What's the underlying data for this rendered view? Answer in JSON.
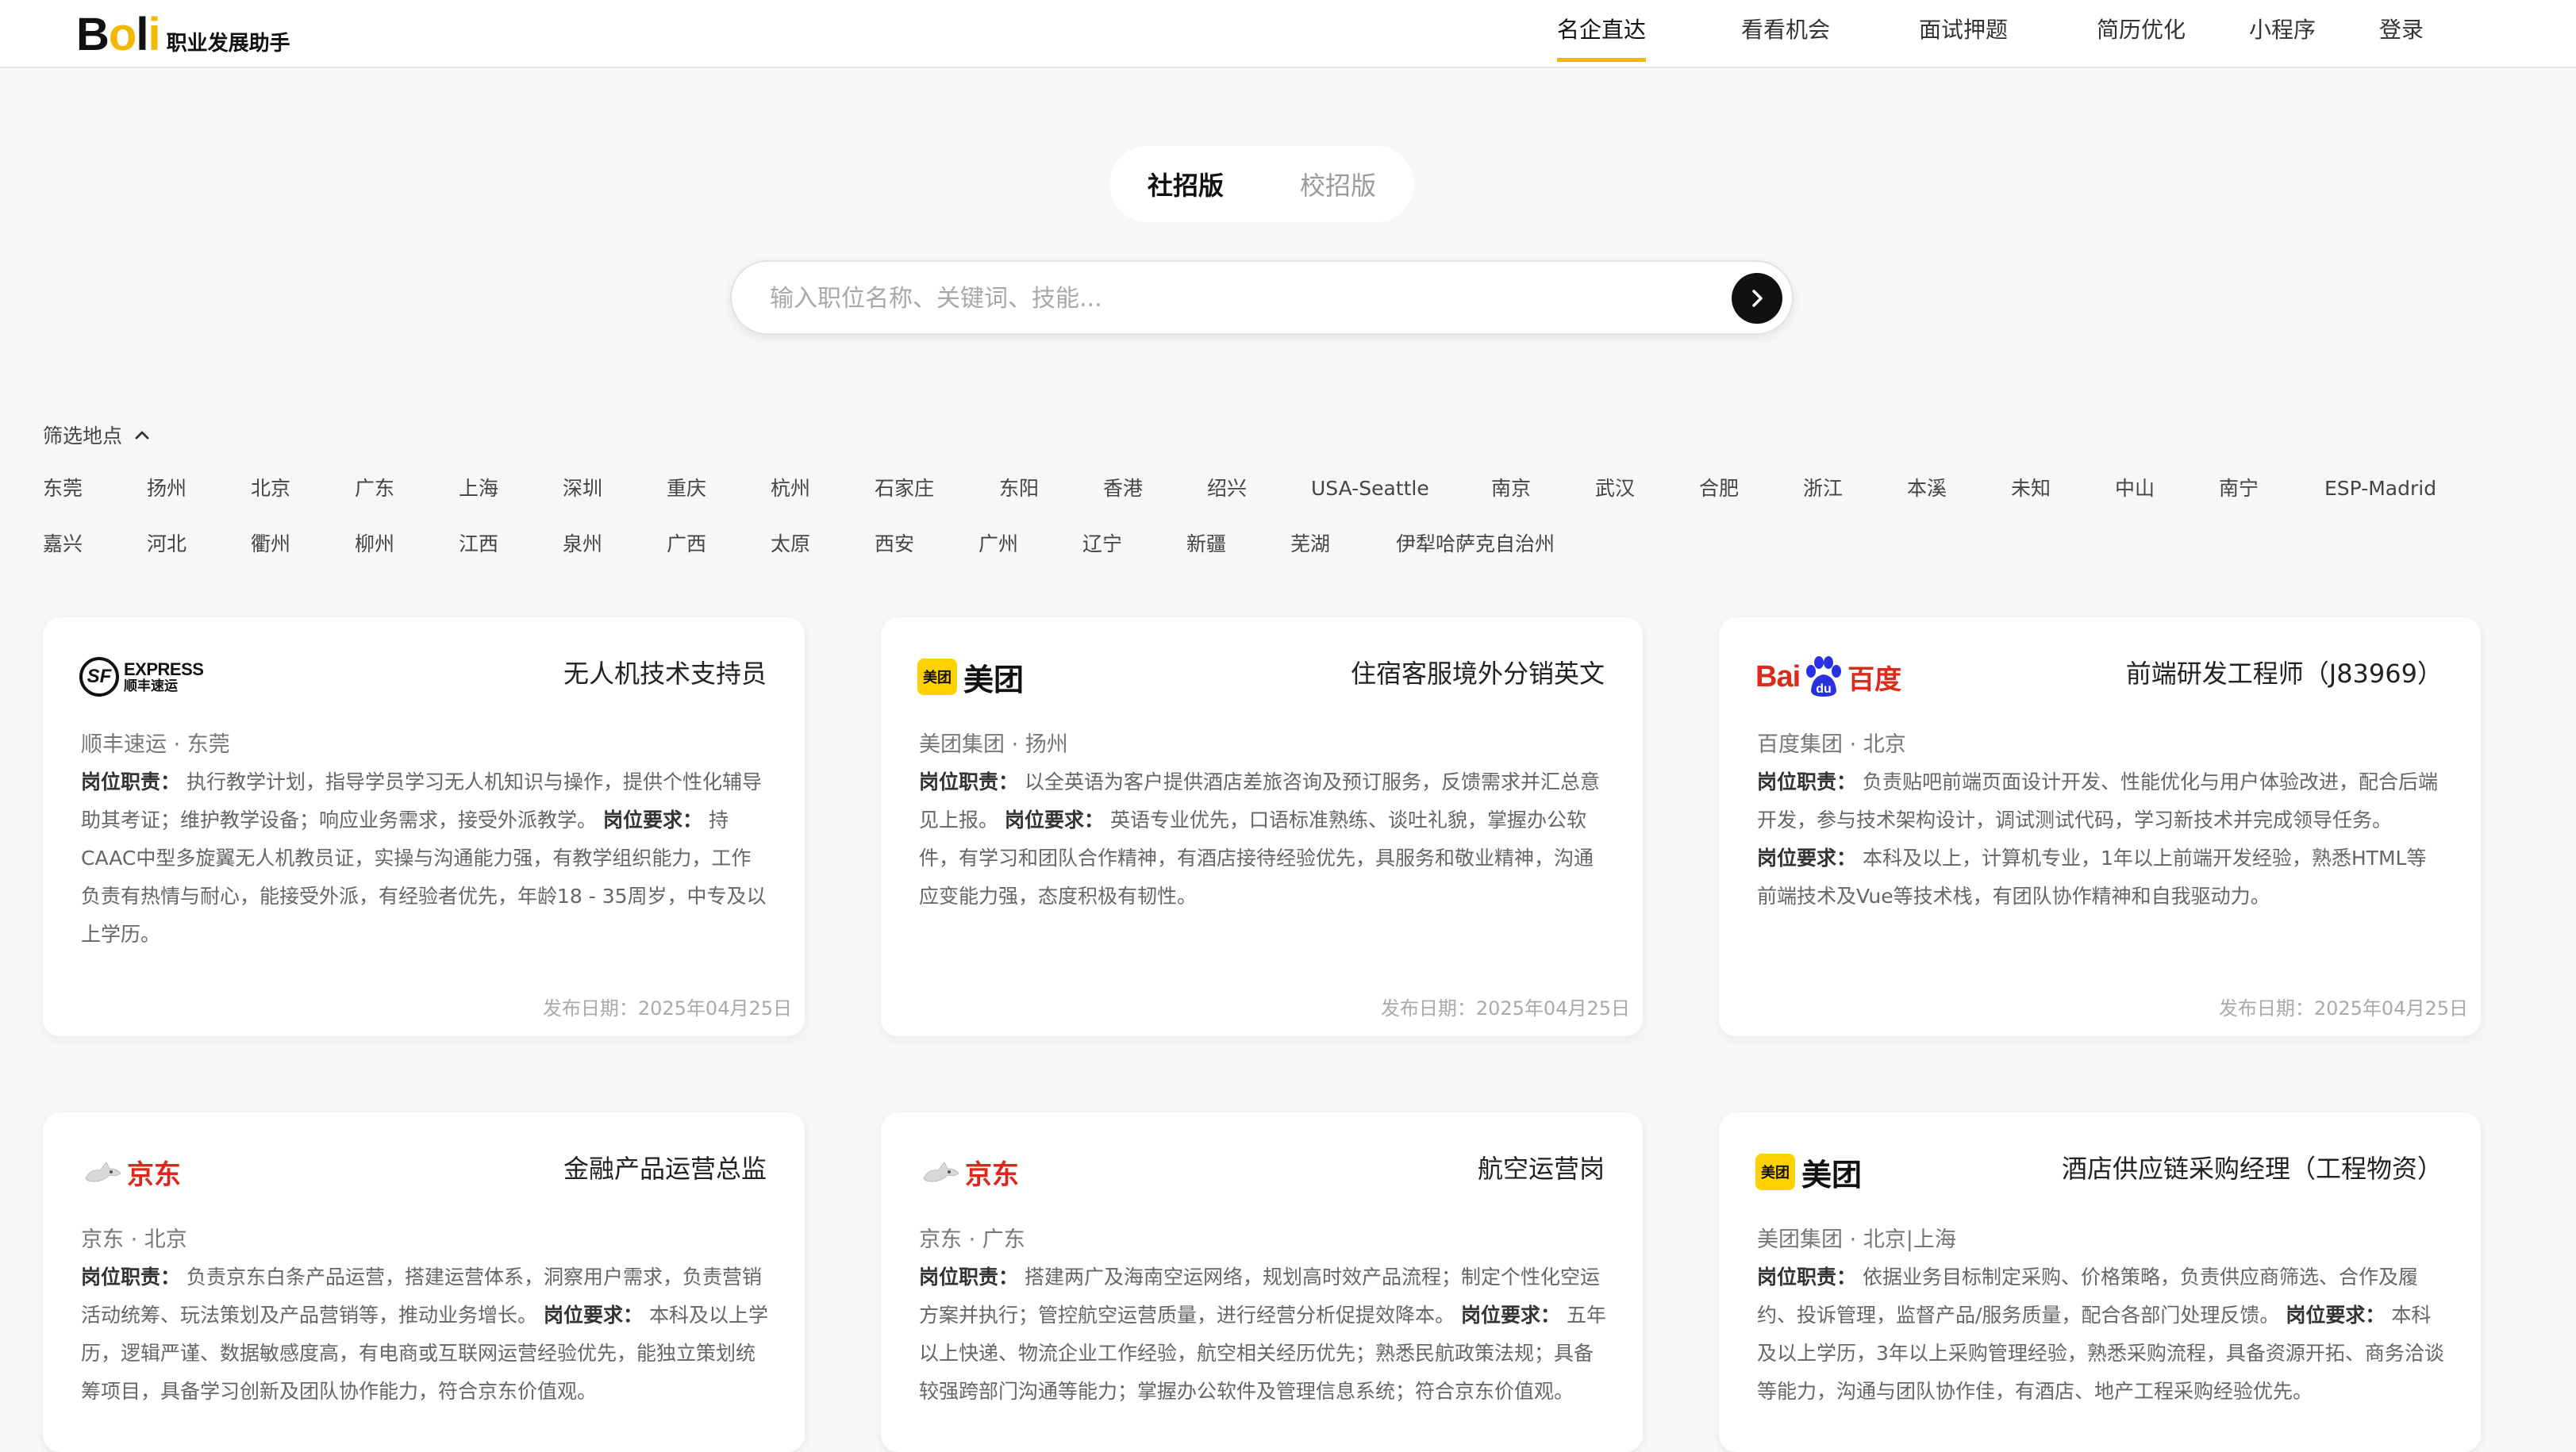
{
  "brand": {
    "logo_b": "B",
    "logo_o": "o",
    "logo_l": "l",
    "logo_i": "i",
    "subtitle": "职业发展助手"
  },
  "nav": [
    {
      "label": "名企直达",
      "active": true
    },
    {
      "label": "看看机会"
    },
    {
      "label": "面试押题"
    },
    {
      "label": "简历优化"
    },
    {
      "label": "小程序"
    },
    {
      "label": "登录"
    }
  ],
  "tabs": {
    "social": "社招版",
    "campus": "校招版"
  },
  "search": {
    "placeholder": "输入职位名称、关键词、技能..."
  },
  "filter": {
    "title": "筛选地点",
    "row1": [
      "东莞",
      "扬州",
      "北京",
      "广东",
      "上海",
      "深圳",
      "重庆",
      "杭州",
      "石家庄",
      "东阳",
      "香港",
      "绍兴",
      "USA-Seattle",
      "南京",
      "武汉",
      "合肥",
      "浙江",
      "本溪",
      "未知",
      "中山",
      "南宁",
      "ESP-Madrid"
    ],
    "row2": [
      "嘉兴",
      "河北",
      "衢州",
      "柳州",
      "江西",
      "泉州",
      "广西",
      "太原",
      "西安",
      "广州",
      "辽宁",
      "新疆",
      "芜湖",
      "伊犁哈萨克自治州"
    ]
  },
  "labels": {
    "duty": "岗位职责：",
    "req": "岗位要求：",
    "date_prefix": "发布日期："
  },
  "logos": {
    "sf_mark": "SF",
    "sf_en": "EXPRESS",
    "sf_cn": "顺丰速运",
    "meituan_badge": "美团",
    "meituan_text": "美团",
    "baidu_bai": "Bai",
    "baidu_du": "du",
    "baidu_cn": "百度",
    "jd_text": "京东"
  },
  "jobs": [
    {
      "title": "无人机技术支持员",
      "company": "顺丰速运 · 东莞",
      "duty": "执行教学计划，指导学员学习无人机知识与操作，提供个性化辅导助其考证；维护教学设备；响应业务需求，接受外派教学。",
      "req": "持CAAC中型多旋翼无人机教员证，实操与沟通能力强，有教学组织能力，工作负责有热情与耐心，能接受外派，有经验者优先，年龄18 - 35周岁，中专及以上学历。",
      "date": "2025年04月25日"
    },
    {
      "title": "住宿客服境外分销英文",
      "company": "美团集团 · 扬州",
      "duty": "以全英语为客户提供酒店差旅咨询及预订服务，反馈需求并汇总意见上报。",
      "req": "英语专业优先，口语标准熟练、谈吐礼貌，掌握办公软件，有学习和团队合作精神，有酒店接待经验优先，具服务和敬业精神，沟通应变能力强，态度积极有韧性。",
      "date": "2025年04月25日"
    },
    {
      "title": "前端研发工程师（J83969）",
      "company": "百度集团 · 北京",
      "duty": "负责贴吧前端页面设计开发、性能优化与用户体验改进，配合后端开发，参与技术架构设计，调试测试代码，学习新技术并完成领导任务。",
      "req": "本科及以上，计算机专业，1年以上前端开发经验，熟悉HTML等前端技术及Vue等技术栈，有团队协作精神和自我驱动力。",
      "date": "2025年04月25日"
    },
    {
      "title": "金融产品运营总监",
      "company": "京东 · 北京",
      "duty": "负责京东白条产品运营，搭建运营体系，洞察用户需求，负责营销活动统筹、玩法策划及产品营销等，推动业务增长。",
      "req": "本科及以上学历，逻辑严谨、数据敏感度高，有电商或互联网运营经验优先，能独立策划统筹项目，具备学习创新及团队协作能力，符合京东价值观。",
      "date": ""
    },
    {
      "title": "航空运营岗",
      "company": "京东 · 广东",
      "duty": "搭建两广及海南空运网络，规划高时效产品流程；制定个性化空运方案并执行；管控航空运营质量，进行经营分析促提效降本。",
      "req": "五年以上快递、物流企业工作经验，航空相关经历优先；熟悉民航政策法规；具备较强跨部门沟通等能力；掌握办公软件及管理信息系统；符合京东价值观。",
      "date": ""
    },
    {
      "title": "酒店供应链采购经理（工程物资）",
      "company": "美团集团 · 北京|上海",
      "duty": "依据业务目标制定采购、价格策略，负责供应商筛选、合作及履约、投诉管理，监督产品/服务质量，配合各部门处理反馈。",
      "req": "本科及以上学历，3年以上采购管理经验，熟悉采购流程，具备资源开拓、商务洽谈等能力，沟通与团队协作佳，有酒店、地产工程采购经验优先。",
      "date": ""
    }
  ]
}
